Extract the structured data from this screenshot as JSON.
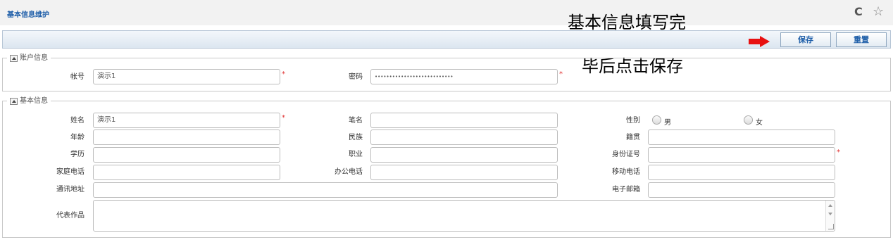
{
  "header": {
    "title": "基本信息维护",
    "refresh_icon": "refresh-icon",
    "favorite_icon": "star-icon"
  },
  "toolbar": {
    "save_label": "保存",
    "reset_label": "重置",
    "arrow_icon": "right-arrow-icon",
    "arrow_color": "#e81010"
  },
  "annotation": {
    "line1": "基本信息填写完",
    "line2": "毕后点击保存"
  },
  "account_section": {
    "legend": "账户信息",
    "username_label": "帐号",
    "username_value": "演示1",
    "password_label": "密码",
    "password_value": "•••••••••••••••••••••••••••"
  },
  "basic_section": {
    "legend": "基本信息",
    "name_label": "姓名",
    "name_value": "演示1",
    "pen_name_label": "笔名",
    "pen_name_value": "",
    "gender_label": "性别",
    "gender_male": "男",
    "gender_female": "女",
    "age_label": "年龄",
    "age_value": "",
    "ethnicity_label": "民族",
    "ethnicity_value": "",
    "native_place_label": "籍贯",
    "native_place_value": "",
    "education_label": "学历",
    "education_value": "",
    "occupation_label": "职业",
    "occupation_value": "",
    "id_number_label": "身份证号",
    "id_number_value": "",
    "home_phone_label": "家庭电话",
    "home_phone_value": "",
    "office_phone_label": "办公电话",
    "office_phone_value": "",
    "mobile_label": "移动电话",
    "mobile_value": "",
    "address_label": "通讯地址",
    "address_value": "",
    "email_label": "电子邮箱",
    "email_value": "",
    "works_label": "代表作品",
    "works_value": ""
  },
  "required_mark": "*"
}
